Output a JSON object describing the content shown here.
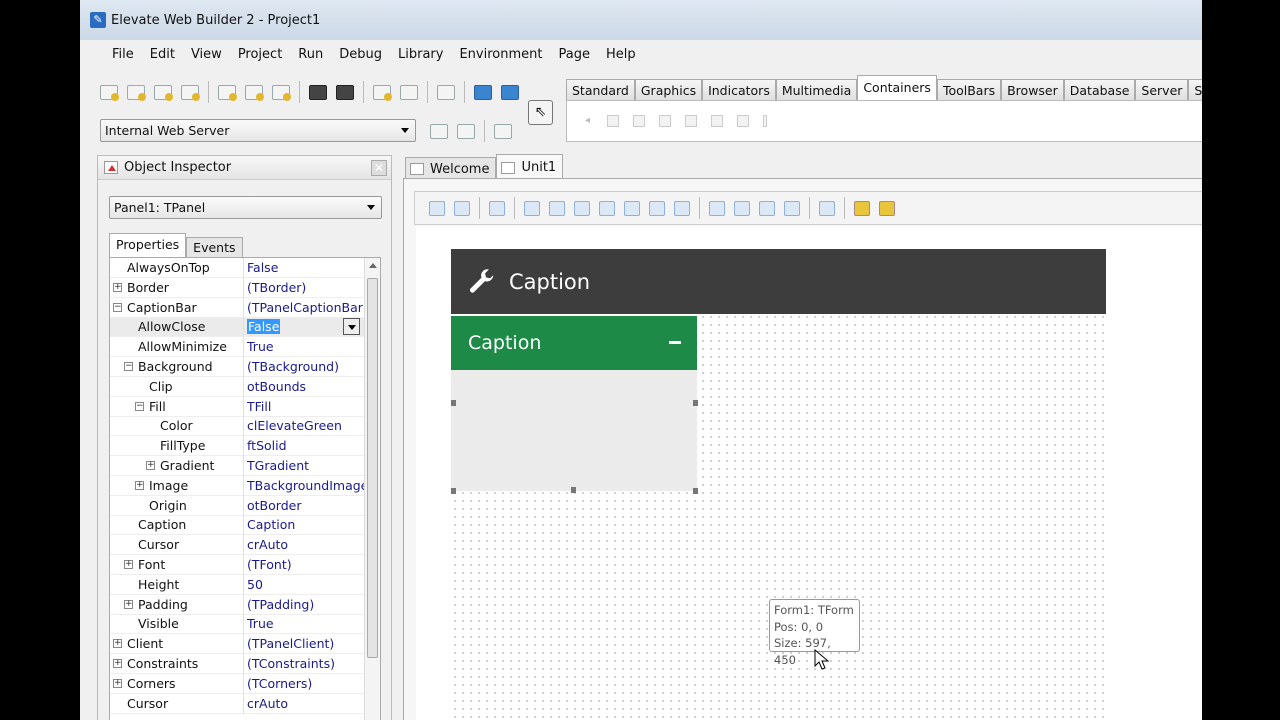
{
  "window": {
    "title": "Elevate Web Builder 2 - Project1"
  },
  "menu": [
    "File",
    "Edit",
    "View",
    "Project",
    "Run",
    "Debug",
    "Library",
    "Environment",
    "Page",
    "Help"
  ],
  "toolbar": {
    "icons": [
      "new-project-icon",
      "new-form-icon",
      "new-unit-icon",
      "new-component-icon",
      "open-icon",
      "open-project-icon",
      "open-folder-icon",
      "save-icon",
      "save-all-icon",
      "add-to-project-icon",
      "remove-from-project-icon",
      "toggle-code-icon",
      "run-icon",
      "run-browser-icon"
    ],
    "server_select": "Internal Web Server",
    "server_icons": [
      "start-server-icon",
      "stop-server-icon",
      "eraser-icon"
    ]
  },
  "palette": {
    "tabs": [
      "Standard",
      "Graphics",
      "Indicators",
      "Multimedia",
      "Containers",
      "ToolBars",
      "Browser",
      "Database",
      "Server",
      "System"
    ],
    "active_tab": "Containers"
  },
  "inspector": {
    "title": "Object Inspector",
    "object_select": "Panel1: TPanel",
    "tabs": [
      "Properties",
      "Events"
    ],
    "rows": [
      {
        "name": "AlwaysOnTop",
        "value": "False",
        "level": 0,
        "exp": ""
      },
      {
        "name": "Border",
        "value": "(TBorder)",
        "level": 0,
        "exp": "+"
      },
      {
        "name": "CaptionBar",
        "value": "(TPanelCaptionBar)",
        "level": 0,
        "exp": "-"
      },
      {
        "name": "AllowClose",
        "value": "False",
        "level": 1,
        "exp": "",
        "selected": true
      },
      {
        "name": "AllowMinimize",
        "value": "True",
        "level": 1,
        "exp": ""
      },
      {
        "name": "Background",
        "value": "(TBackground)",
        "level": 1,
        "exp": "-"
      },
      {
        "name": "Clip",
        "value": "otBounds",
        "level": 2,
        "exp": ""
      },
      {
        "name": "Fill",
        "value": "TFill",
        "level": 2,
        "exp": "-"
      },
      {
        "name": "Color",
        "value": "clElevateGreen",
        "level": 3,
        "exp": ""
      },
      {
        "name": "FillType",
        "value": "ftSolid",
        "level": 3,
        "exp": ""
      },
      {
        "name": "Gradient",
        "value": "TGradient",
        "level": 3,
        "exp": "+"
      },
      {
        "name": "Image",
        "value": "TBackgroundImage",
        "level": 2,
        "exp": "+"
      },
      {
        "name": "Origin",
        "value": "otBorder",
        "level": 2,
        "exp": ""
      },
      {
        "name": "Caption",
        "value": "Caption",
        "level": 1,
        "exp": ""
      },
      {
        "name": "Cursor",
        "value": "crAuto",
        "level": 1,
        "exp": ""
      },
      {
        "name": "Font",
        "value": "(TFont)",
        "level": 1,
        "exp": "+"
      },
      {
        "name": "Height",
        "value": "50",
        "level": 1,
        "exp": ""
      },
      {
        "name": "Padding",
        "value": "(TPadding)",
        "level": 1,
        "exp": "+"
      },
      {
        "name": "Visible",
        "value": "True",
        "level": 1,
        "exp": ""
      },
      {
        "name": "Client",
        "value": "(TPanelClient)",
        "level": 0,
        "exp": "+"
      },
      {
        "name": "Constraints",
        "value": "(TConstraints)",
        "level": 0,
        "exp": "+"
      },
      {
        "name": "Corners",
        "value": "(TCorners)",
        "level": 0,
        "exp": "+"
      },
      {
        "name": "Cursor",
        "value": "crAuto",
        "level": 0,
        "exp": ""
      }
    ]
  },
  "designer": {
    "tabs": [
      "Welcome",
      "Unit1"
    ],
    "active_tab": "Unit1",
    "form_caption": "Caption",
    "panel_caption": "Caption",
    "tooltip": {
      "line1": "Form1: TForm",
      "line2": "Pos: 0, 0",
      "line3": "Size: 597, 450"
    }
  },
  "colors": {
    "form_header": "#3d3d3d",
    "panel_caption": "#1d8a47",
    "selection": "#3399ff"
  }
}
